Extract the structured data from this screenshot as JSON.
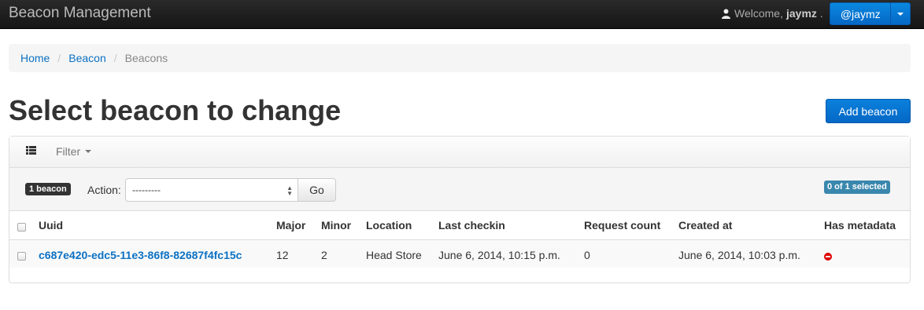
{
  "navbar": {
    "brand": "Beacon Management",
    "welcome_prefix": "Welcome,",
    "username": "jaymz",
    "welcome_suffix": ".",
    "user_button": "@jaymz"
  },
  "breadcrumb": {
    "items": [
      "Home",
      "Beacon",
      "Beacons"
    ]
  },
  "page": {
    "title": "Select beacon to change",
    "add_button": "Add beacon"
  },
  "toolbar": {
    "filter_label": "Filter"
  },
  "actions": {
    "count_badge": "1 beacon",
    "action_label": "Action:",
    "action_value": "---------",
    "go_label": "Go",
    "selected_badge": "0 of 1 selected"
  },
  "table": {
    "columns": [
      "Uuid",
      "Major",
      "Minor",
      "Location",
      "Last checkin",
      "Request count",
      "Created at",
      "Has metadata"
    ],
    "rows": [
      {
        "uuid": "c687e420-edc5-11e3-86f8-82687f4fc15c",
        "major": "12",
        "minor": "2",
        "location": "Head Store",
        "last_checkin": "June 6, 2014, 10:15 p.m.",
        "request_count": "0",
        "created_at": "June 6, 2014, 10:03 p.m.",
        "has_metadata": false
      }
    ]
  },
  "colors": {
    "navbar_bg": "#1b1b1b",
    "primary": "#0568c6",
    "link": "#0c71c3",
    "badge_info": "#3a87ad",
    "danger": "#dd0000"
  }
}
